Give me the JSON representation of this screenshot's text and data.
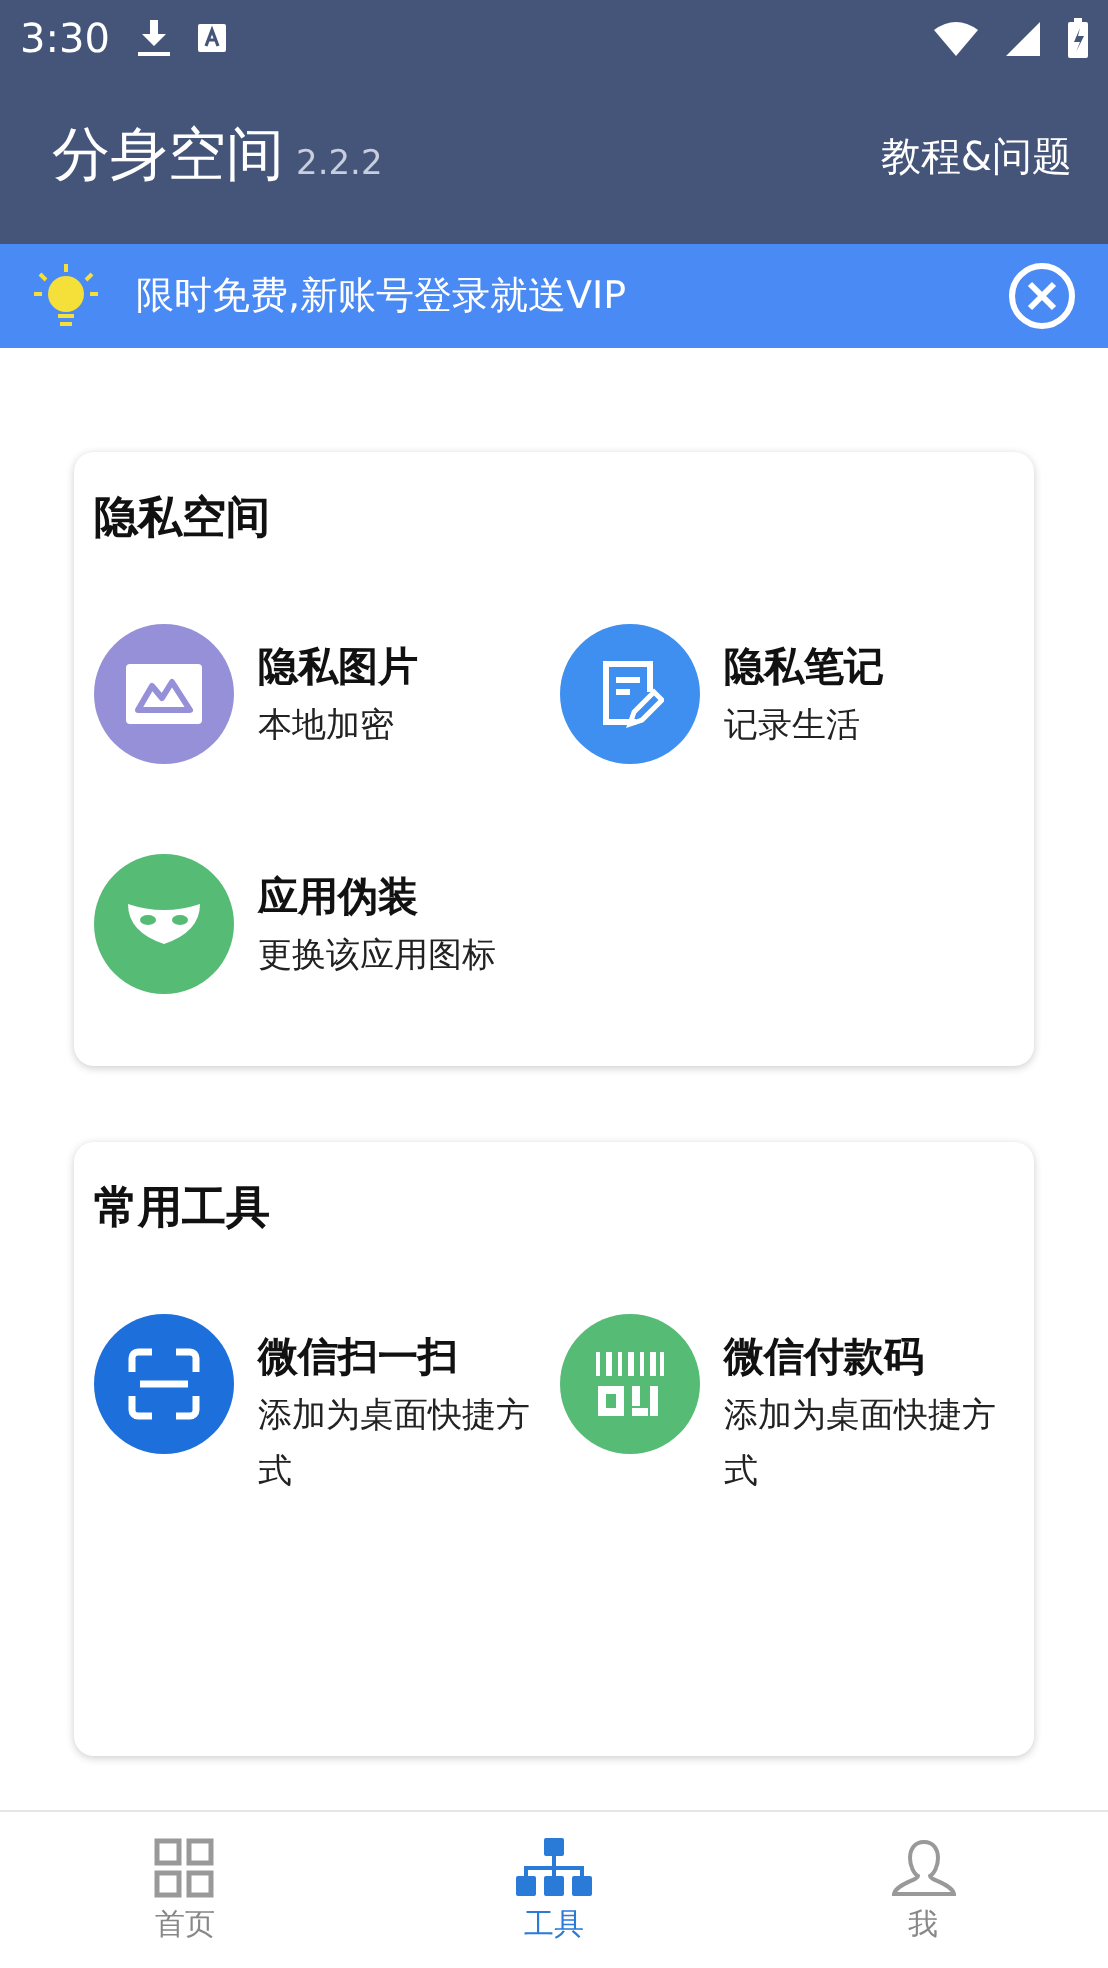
{
  "status_bar": {
    "time": "3:30"
  },
  "app_bar": {
    "title": "分身空间",
    "version": "2.2.2",
    "action": "教程&问题"
  },
  "banner": {
    "text": "限时免费,新账号登录就送VIP"
  },
  "sections": [
    {
      "title": "隐私空间",
      "items": [
        {
          "title": "隐私图片",
          "subtitle": "本地加密",
          "color": "#9590d8"
        },
        {
          "title": "隐私笔记",
          "subtitle": "记录生活",
          "color": "#3f8ff0"
        },
        {
          "title": "应用伪装",
          "subtitle": "更换该应用图标",
          "color": "#56bb74"
        }
      ]
    },
    {
      "title": "常用工具",
      "items": [
        {
          "title": "微信扫一扫",
          "subtitle": "添加为桌面快捷方式",
          "color": "#1d6fdc"
        },
        {
          "title": "微信付款码",
          "subtitle": "添加为桌面快捷方式",
          "color": "#56bb74"
        }
      ]
    }
  ],
  "nav": [
    {
      "label": "首页",
      "selected": false
    },
    {
      "label": "工具",
      "selected": true
    },
    {
      "label": "我",
      "selected": false
    }
  ]
}
